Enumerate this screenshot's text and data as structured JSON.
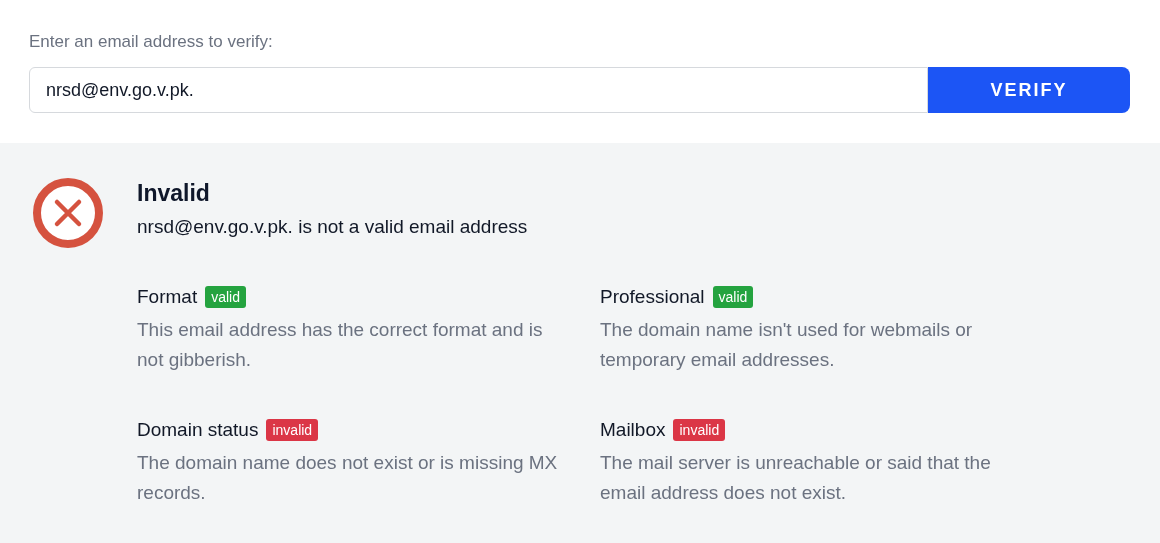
{
  "form": {
    "label": "Enter an email address to verify:",
    "value": "nrsd@env.go.v.pk.",
    "button": "VERIFY"
  },
  "result": {
    "valid": false,
    "title": "Invalid",
    "message": "nrsd@env.go.v.pk. is not a valid email address",
    "checks": [
      {
        "name": "Format",
        "badge": "valid",
        "valid": true,
        "description": "This email address has the correct format and is not gibberish."
      },
      {
        "name": "Professional",
        "badge": "valid",
        "valid": true,
        "description": "The domain name isn't used for webmails or temporary email addresses."
      },
      {
        "name": "Domain status",
        "badge": "invalid",
        "valid": false,
        "description": "The domain name does not exist or is missing MX records."
      },
      {
        "name": "Mailbox",
        "badge": "invalid",
        "valid": false,
        "description": "The mail server is unreachable or said that the email address does not exist."
      }
    ]
  }
}
